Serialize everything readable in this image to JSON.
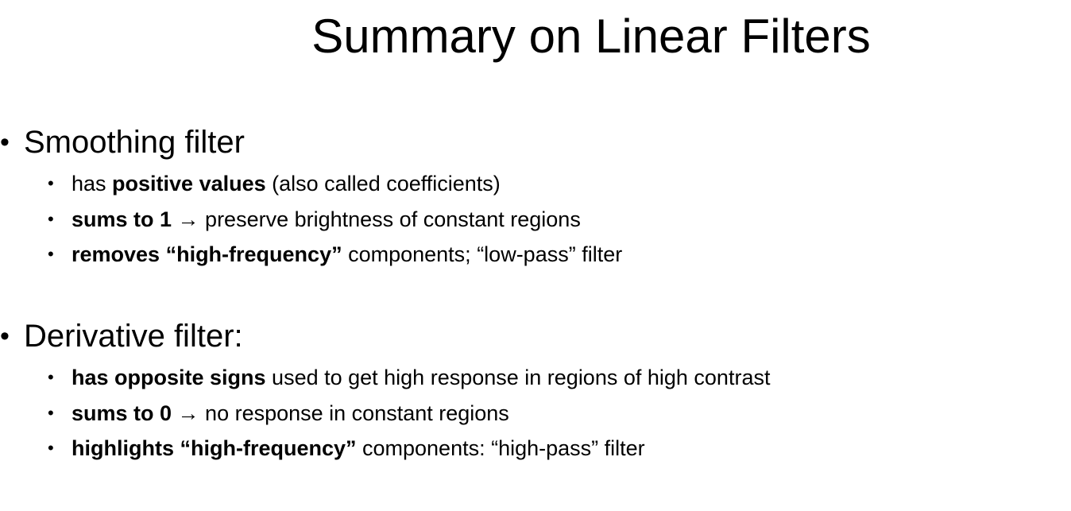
{
  "title": "Summary on Linear Filters",
  "sections": [
    {
      "heading": "Smoothing filter",
      "items": [
        {
          "bold": "",
          "pre": "has ",
          "bold_mid": "positive values",
          "rest": " (also called coefficients)"
        },
        {
          "bold": "sums to 1",
          "rest": " → preserve brightness of constant regions"
        },
        {
          "bold": "removes “high-frequency”",
          "rest": " components; “low-pass” filter"
        }
      ]
    },
    {
      "heading": "Derivative filter:",
      "items": [
        {
          "bold": "has opposite signs",
          "rest": " used to get high response in regions of high contrast"
        },
        {
          "bold": "sums to 0",
          "rest": " → no response in constant regions"
        },
        {
          "bold": "highlights “high-frequency”",
          "rest": " components: “high-pass” filter"
        }
      ]
    }
  ],
  "bullet_glyph": "•"
}
